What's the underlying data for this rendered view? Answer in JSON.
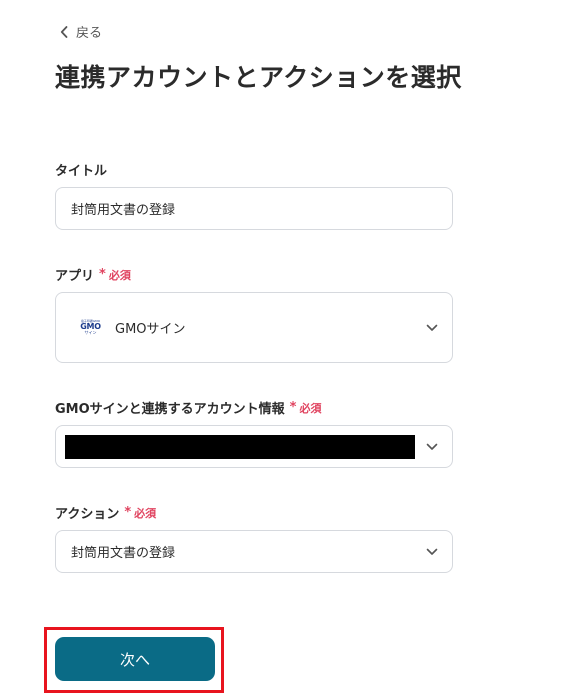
{
  "back": {
    "label": "戻る"
  },
  "page_title": "連携アカウントとアクションを選択",
  "fields": {
    "title": {
      "label": "タイトル",
      "value": "封筒用文書の登録"
    },
    "app": {
      "label": "アプリ",
      "required": "必須",
      "logo_tagline": "電子印鑑GMO",
      "logo_main": "GMO",
      "logo_sub": "サイン",
      "value": "GMOサイン"
    },
    "account": {
      "label": "GMOサインと連携するアカウント情報",
      "required": "必須"
    },
    "action": {
      "label": "アクション",
      "required": "必須",
      "value": "封筒用文書の登録"
    }
  },
  "next_button": {
    "label": "次へ"
  },
  "colors": {
    "primary": "#0a6b86",
    "required": "#e0435f",
    "highlight": "#e8141e"
  }
}
